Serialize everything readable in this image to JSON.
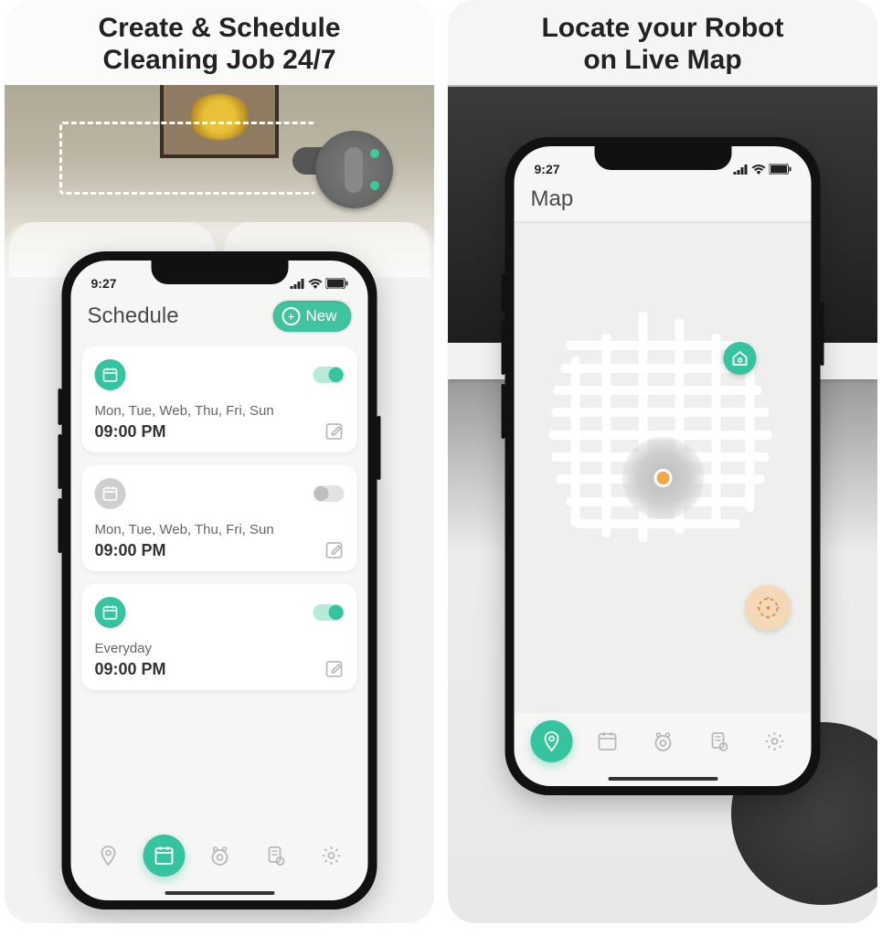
{
  "left": {
    "headline_l1": "Create & Schedule",
    "headline_l2": "Cleaning Job 24/7",
    "status_time": "9:27",
    "screen_title": "Schedule",
    "new_button": "New",
    "cards": [
      {
        "days": "Mon, Tue, Web, Thu, Fri, Sun",
        "time": "09:00 PM",
        "enabled": true
      },
      {
        "days": "Mon, Tue, Web, Thu, Fri, Sun",
        "time": "09:00 PM",
        "enabled": false
      },
      {
        "days": "Everyday",
        "time": "09:00 PM",
        "enabled": true
      }
    ],
    "tabs": [
      "location",
      "schedule",
      "robot",
      "report",
      "settings"
    ],
    "active_tab": 1
  },
  "right": {
    "headline_l1": "Locate your Robot",
    "headline_l2": "on Live Map",
    "status_time": "9:27",
    "screen_title": "Map",
    "tabs": [
      "location",
      "schedule",
      "robot",
      "report",
      "settings"
    ],
    "active_tab": 0
  },
  "colors": {
    "accent": "#35c3a0"
  }
}
